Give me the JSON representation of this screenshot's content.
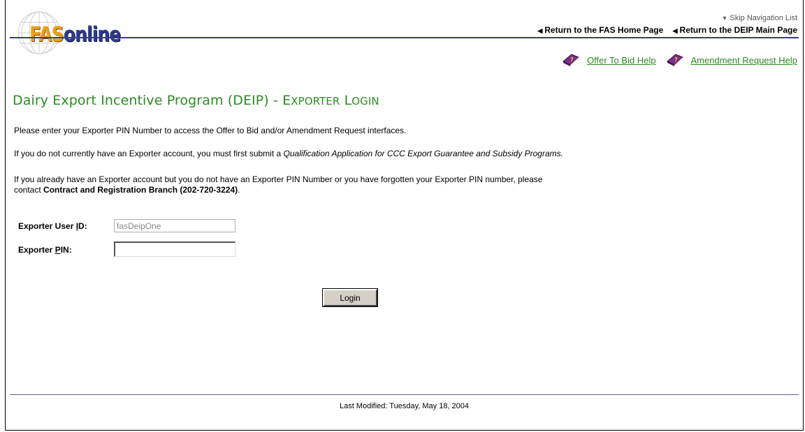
{
  "header": {
    "logo_fas": "FAS",
    "logo_online": "online",
    "skip_nav": "Skip Navigation List",
    "links": [
      {
        "label": "Return to the FAS Home Page"
      },
      {
        "label": "Return to the DEIP Main Page"
      }
    ]
  },
  "help": {
    "offer_to_bid": "Offer To Bid Help",
    "amendment_request": "Amendment Request Help"
  },
  "title": {
    "main": "Dairy Export Incentive Program (DEIP) - ",
    "e_cap": "E",
    "e_rest": "XPORTER",
    "l_cap": "L",
    "l_rest": "OGIN"
  },
  "paragraphs": {
    "p1": "Please enter your Exporter PIN Number to access the Offer to Bid and/or Amendment Request interfaces.",
    "p2_pre": "If you do not currently have an Exporter account, you must first submit a ",
    "p2_italic": "Qualification Application for CCC Export Guarantee and Subsidy Programs.",
    "p3_line1": "If you already have an Exporter account but you do not have an Exporter PIN Number or you have forgotten your Exporter PIN number, please",
    "p3_pre": "contact ",
    "p3_bold": "Contract and Registration Branch (202-720-3224)",
    "p3_post": "."
  },
  "form": {
    "userid_label_pre": "Exporter User ",
    "userid_label_u": "I",
    "userid_label_post": "D:",
    "userid_value": "fasDeipOne",
    "pin_label_pre": "Exporter ",
    "pin_label_u": "P",
    "pin_label_post": "IN:",
    "pin_value": "",
    "login_label": "Login"
  },
  "footer": {
    "last_modified": "Last Modified:  Tuesday, May 18, 2004"
  },
  "colors": {
    "title_green": "#2c8a22",
    "link_green": "#2c8a22",
    "rule_blue": "#3a3a8c"
  }
}
